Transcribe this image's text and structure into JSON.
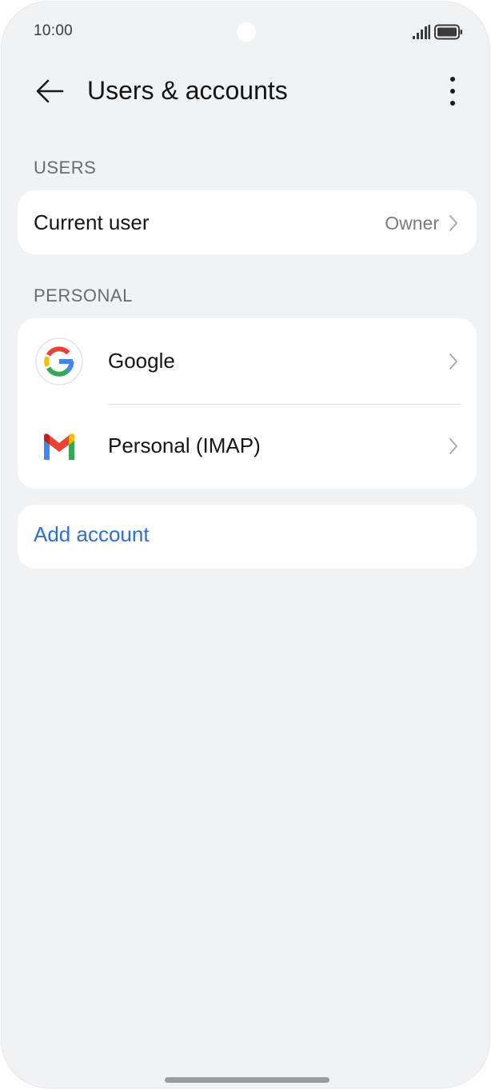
{
  "status_bar": {
    "time": "10:00"
  },
  "header": {
    "title": "Users & accounts",
    "back_icon": "arrow-left-icon",
    "more_icon": "vertical-ellipsis-icon"
  },
  "sections": {
    "users": {
      "header": "USERS",
      "items": [
        {
          "label": "Current user",
          "value": "Owner"
        }
      ]
    },
    "personal": {
      "header": "PERSONAL",
      "items": [
        {
          "label": "Google",
          "icon": "google-icon"
        },
        {
          "label": "Personal (IMAP)",
          "icon": "gmail-icon"
        }
      ]
    }
  },
  "add_account": {
    "label": "Add account"
  },
  "colors": {
    "background": "#f1f2f4",
    "card": "#ffffff",
    "accent": "#2e6fd4",
    "text_primary": "#161616",
    "text_secondary": "#6a6b6e"
  }
}
